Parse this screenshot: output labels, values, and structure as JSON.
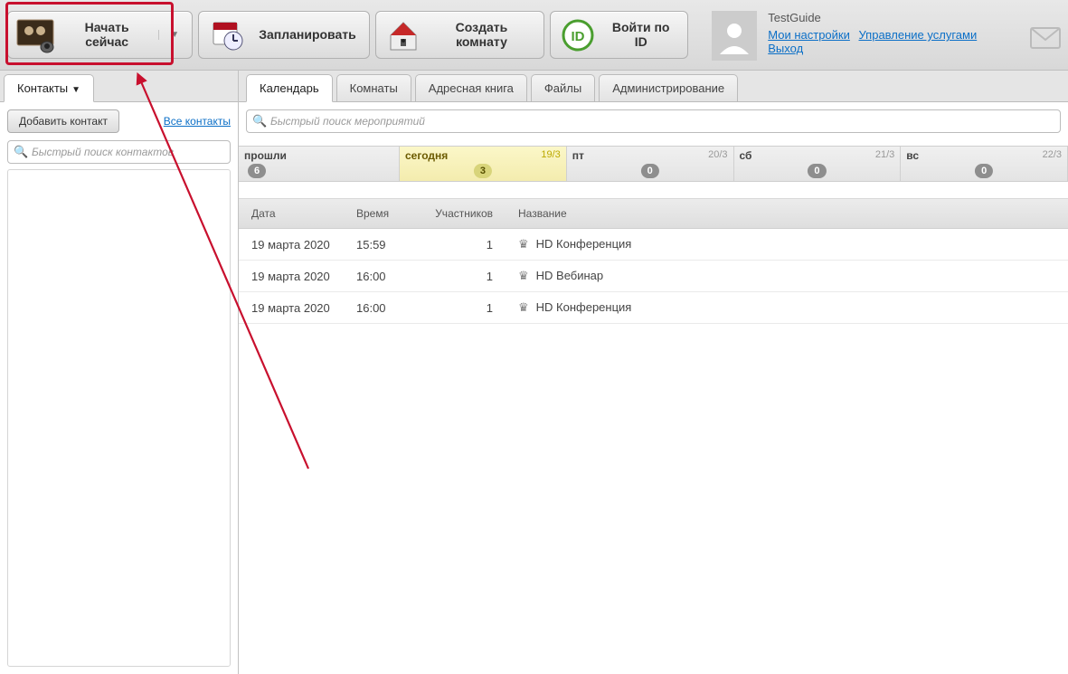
{
  "toolbar": {
    "start_now": "Начать сейчас",
    "schedule": "Запланировать",
    "create_room": "Создать комнату",
    "join_by_id": "Войти по ID"
  },
  "user": {
    "name": "TestGuide",
    "my_settings": "Мои настройки",
    "manage_services": "Управление услугами",
    "logout": "Выход"
  },
  "sidebar": {
    "tab_contacts": "Контакты",
    "add_contact": "Добавить контакт",
    "all_contacts": "Все контакты",
    "search_placeholder": "Быстрый поиск контактов"
  },
  "main_tabs": {
    "calendar": "Календарь",
    "rooms": "Комнаты",
    "address_book": "Адресная книга",
    "files": "Файлы",
    "admin": "Администрирование"
  },
  "calendar": {
    "search_placeholder": "Быстрый поиск мероприятий",
    "datebar": [
      {
        "label": "прошли",
        "date": "",
        "count": "6",
        "key": "past"
      },
      {
        "label": "сегодня",
        "date": "19/3",
        "count": "3",
        "key": "today"
      },
      {
        "label": "пт",
        "date": "20/3",
        "count": "0"
      },
      {
        "label": "сб",
        "date": "21/3",
        "count": "0"
      },
      {
        "label": "вс",
        "date": "22/3",
        "count": "0"
      }
    ],
    "headers": {
      "date": "Дата",
      "time": "Время",
      "participants": "Участников",
      "name": "Название"
    },
    "events": [
      {
        "date": "19 марта 2020",
        "time": "15:59",
        "participants": "1",
        "name": "HD Конференция"
      },
      {
        "date": "19 марта 2020",
        "time": "16:00",
        "participants": "1",
        "name": "HD Вебинар"
      },
      {
        "date": "19 марта 2020",
        "time": "16:00",
        "participants": "1",
        "name": "HD Конференция"
      }
    ]
  }
}
